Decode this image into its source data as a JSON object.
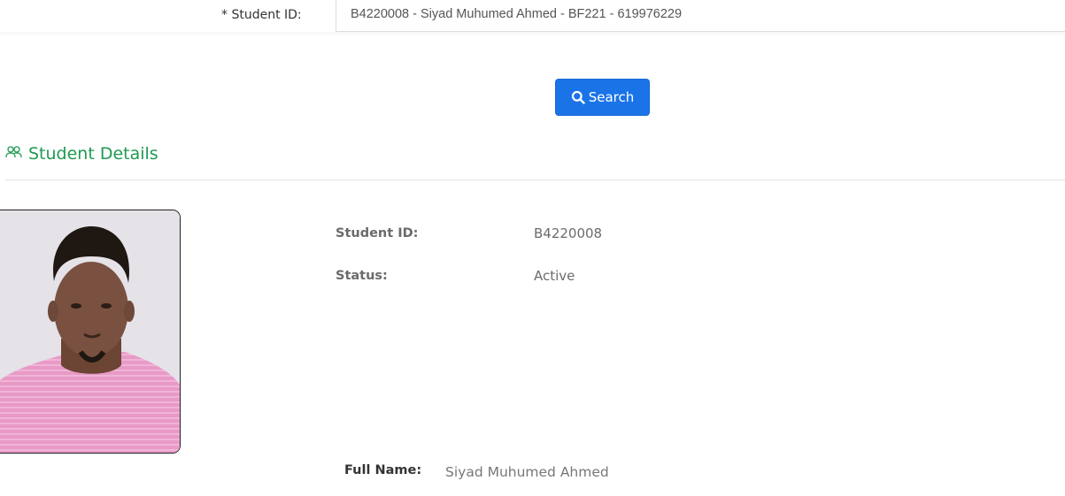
{
  "search_form": {
    "student_id_label": "* Student ID:",
    "student_id_value": "B4220008 - Siyad Muhumed Ahmed - BF221 - 619976229",
    "search_button_label": "Search"
  },
  "student_details": {
    "section_title": "Student Details",
    "photo_icon": "person-photo",
    "fields": {
      "student_id_label": "Student ID:",
      "student_id_value": "B4220008",
      "status_label": "Status:",
      "status_value": "Active",
      "full_name_label": "Full Name:",
      "full_name_value": "Siyad Muhumed Ahmed"
    }
  },
  "colors": {
    "primary_button": "#1a74e8",
    "section_title": "#1e9a52"
  },
  "icons": {
    "search": "search-icon",
    "section": "users-icon"
  }
}
